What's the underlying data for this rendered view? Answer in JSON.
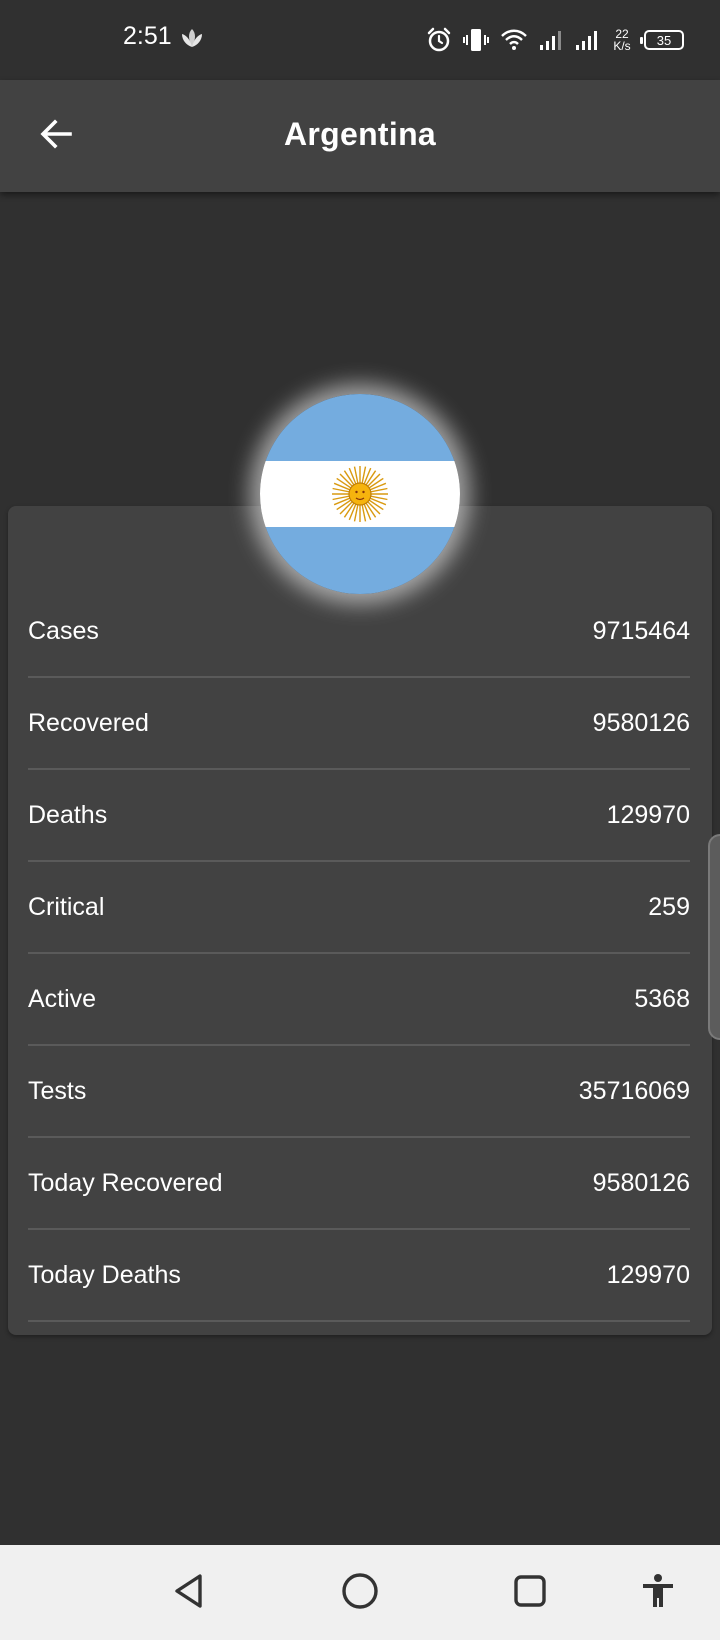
{
  "status_bar": {
    "time": "2:51",
    "net_speed_value": "22",
    "net_speed_unit": "K/s",
    "battery": "35",
    "icons": [
      "leaf-icon",
      "alarm-icon",
      "vibrate-icon",
      "wifi-icon",
      "signal-icon",
      "signal-icon",
      "battery-icon"
    ]
  },
  "app_bar": {
    "back_icon": "arrow-left-icon",
    "title": "Argentina"
  },
  "flag": {
    "country": "Argentina",
    "colors": {
      "blue": "#74ACDF",
      "white": "#FFFFFF",
      "sun": "#F6B40E",
      "sun_edge": "#85340A"
    }
  },
  "stats": [
    {
      "label": "Cases",
      "value": "9715464"
    },
    {
      "label": "Recovered",
      "value": "9580126"
    },
    {
      "label": "Deaths",
      "value": "129970"
    },
    {
      "label": "Critical",
      "value": "259"
    },
    {
      "label": "Active",
      "value": "5368"
    },
    {
      "label": "Tests",
      "value": "35716069"
    },
    {
      "label": "Today Recovered",
      "value": "9580126"
    },
    {
      "label": "Today Deaths",
      "value": "129970"
    }
  ],
  "nav_bar": {
    "buttons": [
      "back-triangle-icon",
      "home-circle-icon",
      "recents-square-icon",
      "accessibility-icon"
    ]
  },
  "theme": {
    "background": "#303030",
    "surface": "#424242",
    "divider": "#5a5a5a",
    "nav_background": "#f0f0f0"
  }
}
